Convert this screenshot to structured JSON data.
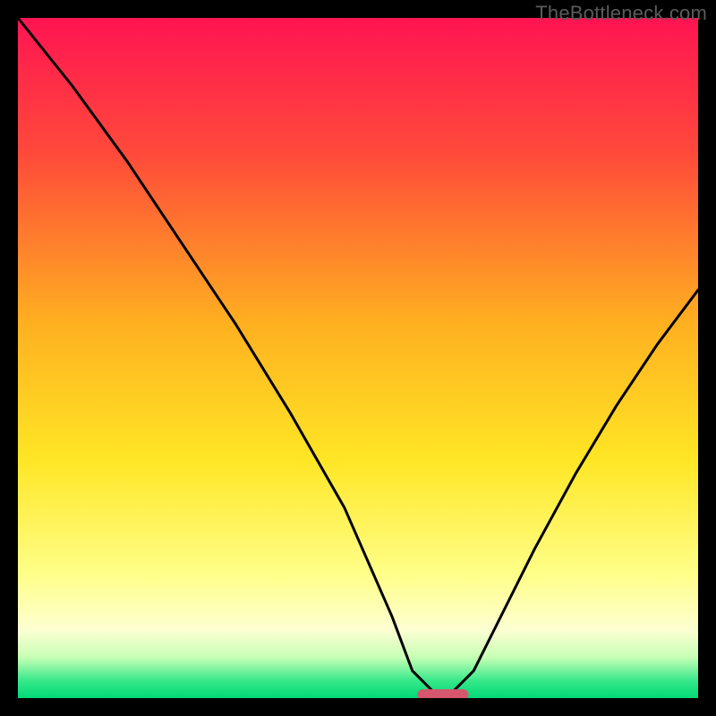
{
  "watermark": "TheBottleneck.com",
  "chart_data": {
    "type": "line",
    "title": "",
    "xlabel": "",
    "ylabel": "",
    "xlim": [
      0,
      100
    ],
    "ylim": [
      0,
      100
    ],
    "grid": false,
    "legend": false,
    "series": [
      {
        "name": "bottleneck-curve",
        "x": [
          0,
          8,
          16,
          24,
          32,
          40,
          48,
          55,
          58,
          61,
          64,
          67,
          70,
          76,
          82,
          88,
          94,
          100
        ],
        "values": [
          100,
          90,
          79,
          67,
          55,
          42,
          28,
          12,
          4,
          1,
          1,
          4,
          10,
          22,
          33,
          43,
          52,
          60
        ]
      }
    ],
    "gradient_stops": [
      {
        "pos": 0.0,
        "color": "#ff1452"
      },
      {
        "pos": 0.2,
        "color": "#ff4a3a"
      },
      {
        "pos": 0.45,
        "color": "#ffb020"
      },
      {
        "pos": 0.65,
        "color": "#ffe625"
      },
      {
        "pos": 0.82,
        "color": "#ffff8a"
      },
      {
        "pos": 0.9,
        "color": "#fdffd2"
      },
      {
        "pos": 0.94,
        "color": "#c7ffb5"
      },
      {
        "pos": 0.975,
        "color": "#35e88a"
      },
      {
        "pos": 1.0,
        "color": "#00d876"
      }
    ],
    "marker": {
      "cx": 62.5,
      "cy": 0.5,
      "w": 7.5,
      "h": 1.6,
      "color": "#d6566d"
    }
  }
}
